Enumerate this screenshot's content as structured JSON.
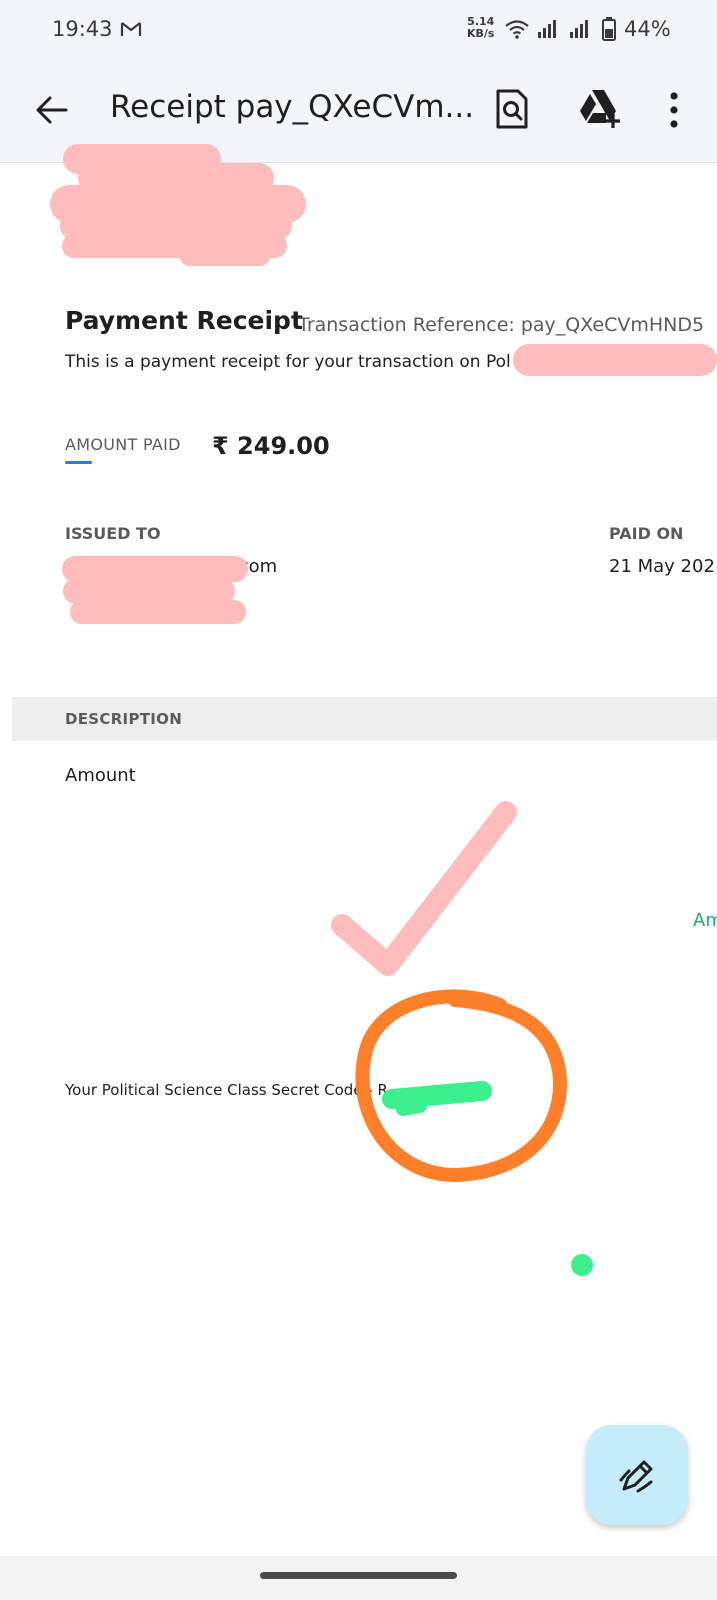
{
  "status_bar": {
    "time": "19:43",
    "net_speed_value": "5.14",
    "net_speed_unit": "KB/s",
    "battery": "44%",
    "icons": [
      "gmail-icon",
      "wifi-icon",
      "signal-icon",
      "signal-icon",
      "battery-icon"
    ]
  },
  "app_bar": {
    "title": "Receipt pay_QXeCVm...",
    "icons": [
      "back-arrow-icon",
      "search-document-icon",
      "drive-add-icon",
      "more-vert-icon"
    ]
  },
  "receipt": {
    "heading": "Payment Receipt",
    "transaction_reference": "Transaction Reference: pay_QXeCVmHND5",
    "description": "This is a payment receipt for your transaction on Pol",
    "amount_paid_label": "AMOUNT PAID",
    "amount_paid_value": "₹ 249.00",
    "issued_to_label": "ISSUED TO",
    "issued_to_value": "ail.com",
    "paid_on_label": "PAID ON",
    "paid_on_value": "21 May 202",
    "description_header": "DESCRIPTION",
    "line_item_label": "Amount",
    "line_item_amount_partial": "Am",
    "secret_code_text": "Your Political Science Class Secret Code - R"
  },
  "colors": {
    "redaction": "#ffbcbd",
    "checkmark": "#ffbcbd",
    "circle_annotation": "#ff7f2a",
    "green_marker": "#3bef8f",
    "accent_blue": "#2c7be5",
    "fab_background": "#c6ecfb"
  },
  "fab": {
    "icon": "draw-pen-icon"
  }
}
